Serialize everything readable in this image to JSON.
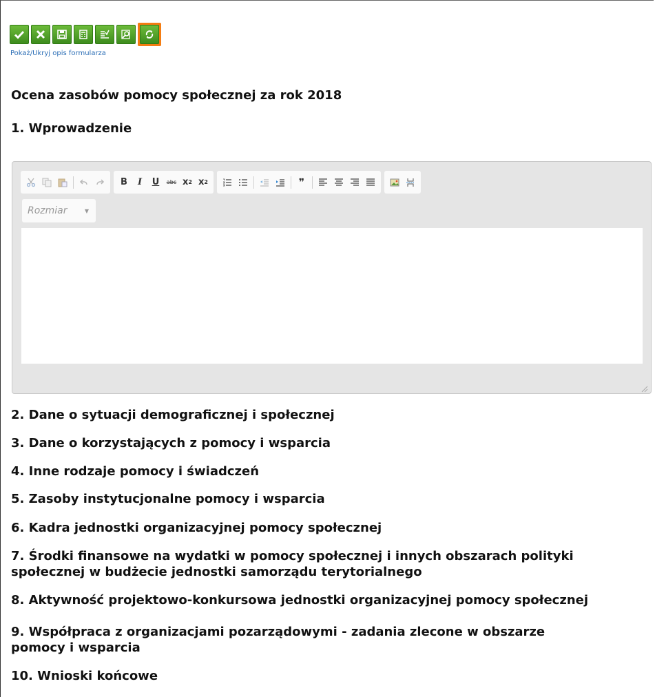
{
  "toolbar": {
    "buttons": [
      {
        "name": "accept",
        "icon": "check-icon"
      },
      {
        "name": "cancel",
        "icon": "close-icon"
      },
      {
        "name": "save",
        "icon": "floppy-icon"
      },
      {
        "name": "calculate",
        "icon": "calculator-icon"
      },
      {
        "name": "validate",
        "icon": "checklist-icon"
      },
      {
        "name": "preview",
        "icon": "search-document-icon"
      },
      {
        "name": "refresh",
        "icon": "refresh-icon",
        "selected": true
      }
    ],
    "toggle_description": "Pokaż/Ukryj opis formularza"
  },
  "form": {
    "title": "Ocena zasobów pomocy społecznej za rok 2018",
    "sections": [
      "1. Wprowadzenie",
      "2. Dane o sytuacji demograficznej i społecznej",
      "3. Dane o korzystających z pomocy i wsparcia",
      "4. Inne rodzaje pomocy i świadczeń",
      "5. Zasoby instytucjonalne pomocy i wsparcia",
      "6. Kadra jednostki organizacyjnej pomocy społecznej",
      "7. Środki finansowe na wydatki w pomocy społecznej i innych obszarach polityki społecznej w budżecie jednostki samorządu terytorialnego",
      "8. Aktywność projektowo-konkursowa jednostki organizacyjnej pomocy społecznej",
      "9. Współpraca z organizacjami pozarządowymi - zadania zlecone w obszarze pomocy i wsparcia",
      "10. Wnioski końcowe"
    ]
  },
  "editor": {
    "size_placeholder": "Rozmiar",
    "content": "",
    "buttons": {
      "bold": "B",
      "italic": "I",
      "underline": "U",
      "strike": "abc",
      "subscript": "x",
      "superscript": "x",
      "sub_mark": "2",
      "sup_mark": "2",
      "blockquote": "❞"
    }
  },
  "colors": {
    "button_green": "#4fa32a",
    "selected_orange": "#f47c12",
    "link_blue": "#2a6db5"
  }
}
